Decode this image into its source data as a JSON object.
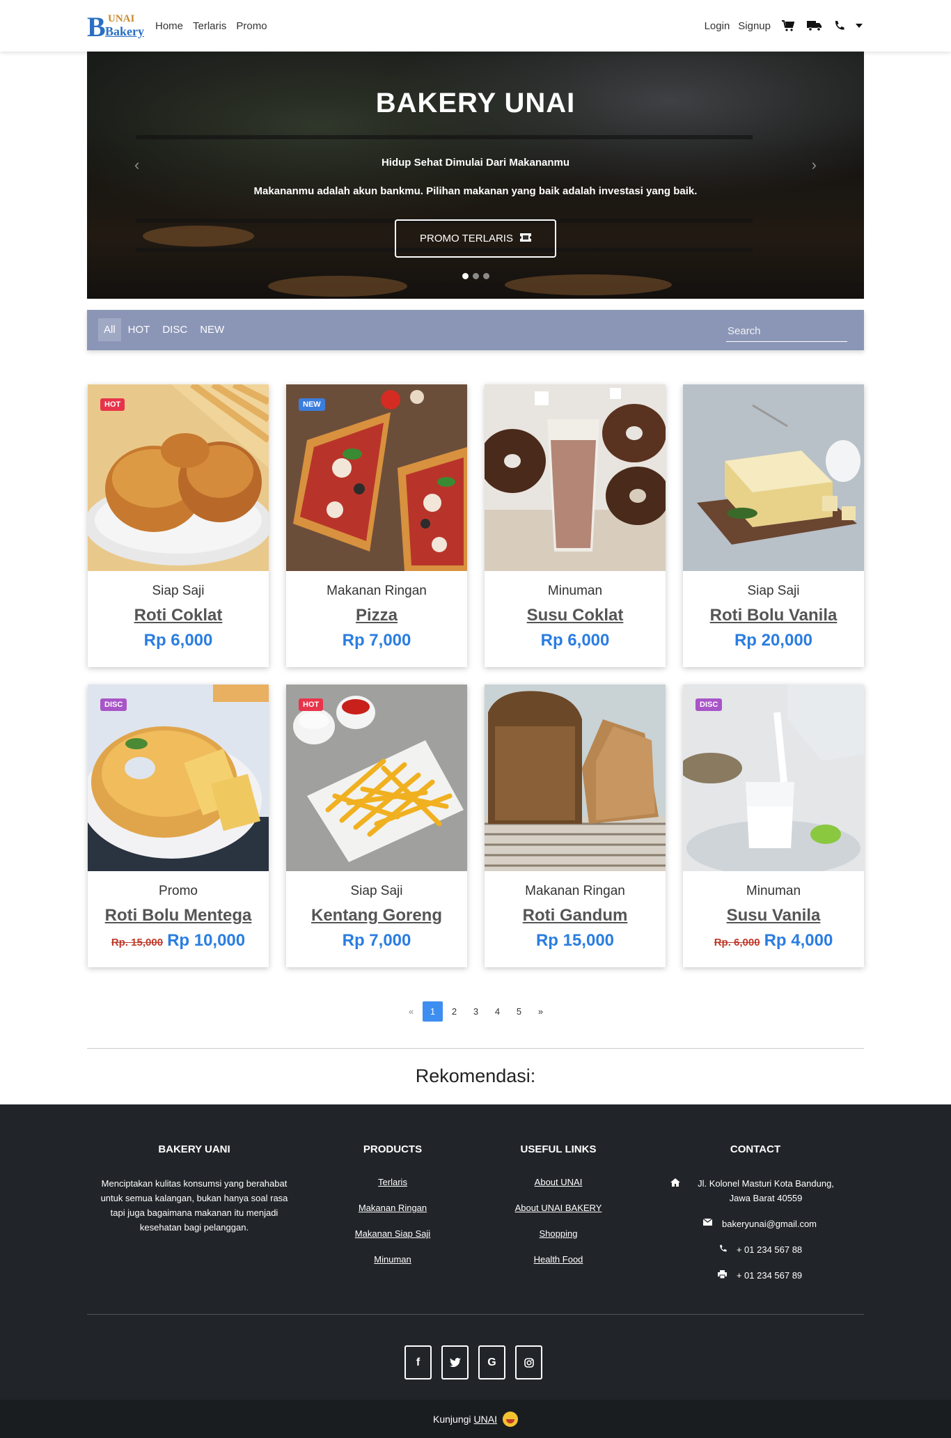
{
  "brand": {
    "logo_text_top": "UNAI",
    "logo_text_main": "Bakery",
    "logo_letter": "B"
  },
  "nav": {
    "links": [
      "Home",
      "Terlaris",
      "Promo"
    ],
    "login": "Login",
    "signup": "Signup",
    "icons": [
      "cart-icon",
      "truck-icon",
      "phone-icon",
      "caret-down-icon"
    ]
  },
  "hero": {
    "title": "BAKERY UNAI",
    "subtitle": "Hidup Sehat Dimulai Dari Makananmu",
    "tagline": "Makananmu adalah akun bankmu. Pilihan makanan yang baik adalah investasi yang baik.",
    "button_label": "PROMO TERLARIS",
    "slides": 3,
    "active_slide": 1
  },
  "filter": {
    "tabs": [
      "All",
      "HOT",
      "DISC",
      "NEW"
    ],
    "active_tab": "All",
    "search_placeholder": "Search"
  },
  "products": [
    {
      "badge": "HOT",
      "category": "Siap Saji",
      "name": "Roti Coklat",
      "price": "Rp 6,000",
      "old_price": ""
    },
    {
      "badge": "NEW",
      "category": "Makanan Ringan",
      "name": "Pizza",
      "price": "Rp 7,000",
      "old_price": ""
    },
    {
      "badge": "",
      "category": "Minuman",
      "name": "Susu Coklat",
      "price": "Rp 6,000",
      "old_price": ""
    },
    {
      "badge": "",
      "category": "Siap Saji",
      "name": "Roti Bolu Vanila",
      "price": "Rp 20,000",
      "old_price": ""
    },
    {
      "badge": "DISC",
      "category": "Promo",
      "name": "Roti Bolu Mentega",
      "price": "Rp 10,000",
      "old_price": "Rp. 15,000"
    },
    {
      "badge": "HOT",
      "category": "Siap Saji",
      "name": "Kentang Goreng",
      "price": "Rp 7,000",
      "old_price": ""
    },
    {
      "badge": "",
      "category": "Makanan Ringan",
      "name": "Roti Gandum",
      "price": "Rp 15,000",
      "old_price": ""
    },
    {
      "badge": "DISC",
      "category": "Minuman",
      "name": "Susu Vanila",
      "price": "Rp 4,000",
      "old_price": "Rp. 6,000"
    }
  ],
  "badge_colors": {
    "HOT": "#e8344a",
    "NEW": "#3b7ddd",
    "DISC": "#a855c8"
  },
  "pagination": {
    "prev": "«",
    "pages": [
      "1",
      "2",
      "3",
      "4",
      "5"
    ],
    "active": "1",
    "next": "»"
  },
  "recommendation_title": "Rekomendasi:",
  "footer": {
    "about": {
      "title": "BAKERY UANI",
      "text": "Menciptakan kulitas konsumsi yang berahabat untuk semua kalangan, bukan hanya soal rasa tapi juga bagaimana makanan itu menjadi kesehatan bagi pelanggan."
    },
    "products": {
      "title": "PRODUCTS",
      "links": [
        "Terlaris",
        "Makanan Ringan",
        "Makanan Siap Saji",
        "Minuman"
      ]
    },
    "useful": {
      "title": "USEFUL LINKS",
      "links": [
        "About UNAI",
        "About UNAI BAKERY",
        "Shopping",
        "Health Food"
      ]
    },
    "contact": {
      "title": "CONTACT",
      "address": "Jl. Kolonel Masturi Kota Bandung, Jawa Barat 40559",
      "email": "bakeryunai@gmail.com",
      "phone": "+ 01 234 567 88",
      "fax": "+ 01 234 567 89"
    },
    "social": [
      "facebook-icon",
      "twitter-icon",
      "google-icon",
      "instagram-icon"
    ],
    "copyright_prefix": "Kunjungi",
    "copyright_link": "UNAI"
  },
  "colors": {
    "accent": "#2a7de1",
    "filter_bar": "#8b96b7",
    "footer_bg": "#212529",
    "page_active": "#3d8ef0"
  }
}
